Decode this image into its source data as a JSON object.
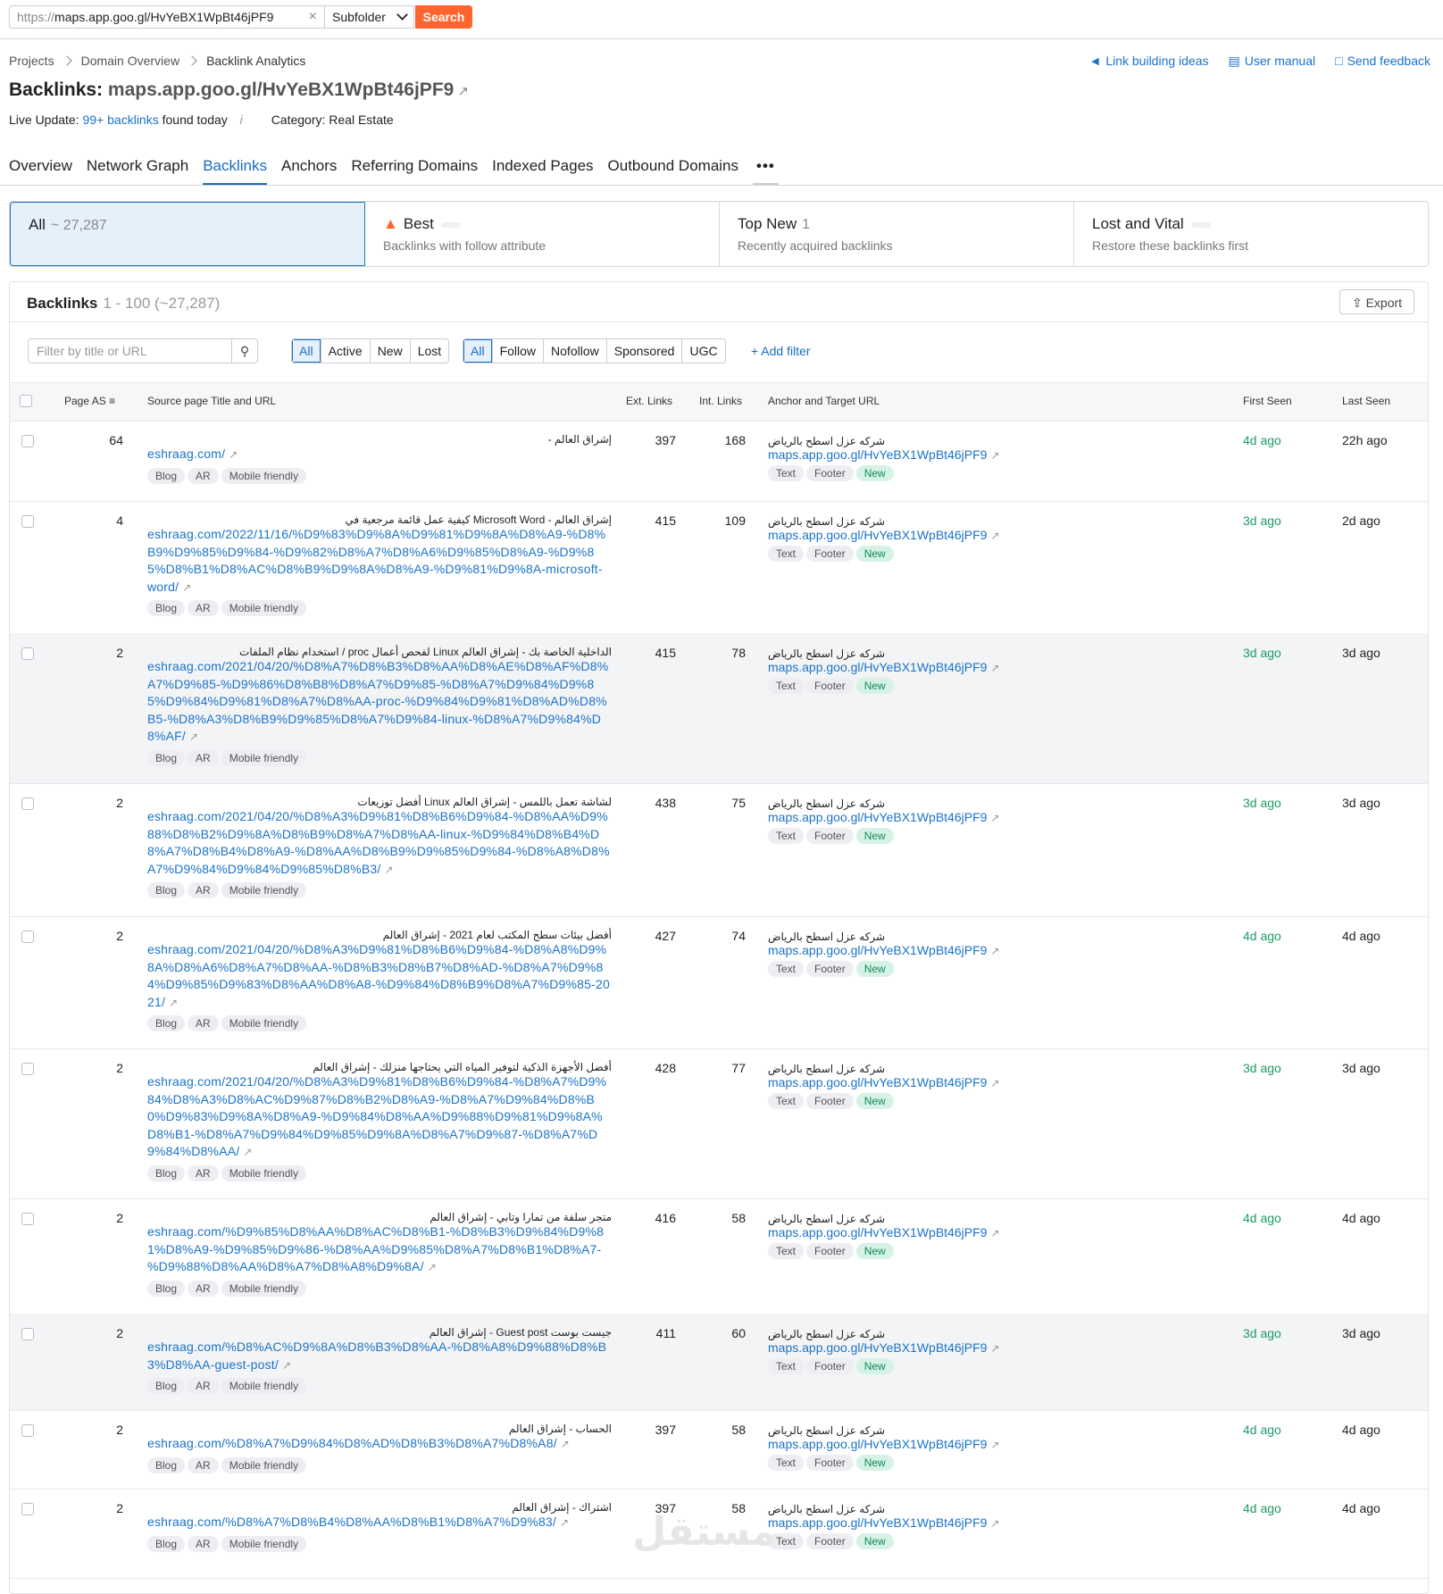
{
  "search": {
    "proto": "https://",
    "value": "maps.app.goo.gl/HvYeBX1WpBt46jPF9",
    "clear": "×",
    "scope": "Subfolder",
    "button": "Search"
  },
  "breadcrumb": [
    "Projects",
    "Domain Overview",
    "Backlink Analytics"
  ],
  "top_links": [
    "Link building ideas",
    "User manual",
    "Send feedback"
  ],
  "title": {
    "prefix": "Backlinks:",
    "domain": "maps.app.goo.gl/HvYeBX1WpBt46jPF9"
  },
  "live": {
    "label": "Live Update:",
    "count": "99+ backlinks",
    "suffix": "found today",
    "info": "i",
    "category_label": "Category:",
    "category": "Real Estate"
  },
  "tabs": [
    "Overview",
    "Network Graph",
    "Backlinks",
    "Anchors",
    "Referring Domains",
    "Indexed Pages",
    "Outbound Domains",
    "•••"
  ],
  "cards": [
    {
      "title": "All",
      "count": "~ 27,287",
      "sub": ""
    },
    {
      "title": "Best",
      "count": "",
      "sub": "Backlinks with follow attribute"
    },
    {
      "title": "Top New",
      "count": "1",
      "sub": "Recently acquired backlinks"
    },
    {
      "title": "Lost and Vital",
      "count": "",
      "sub": "Restore these backlinks first"
    }
  ],
  "panel": {
    "title": "Backlinks",
    "range": "1 - 100 (~27,287)",
    "export": "Export"
  },
  "filter": {
    "placeholder": "Filter by title or URL"
  },
  "seg1": [
    "All",
    "Active",
    "New",
    "Lost"
  ],
  "seg2": [
    "All",
    "Follow",
    "Nofollow",
    "Sponsored",
    "UGC"
  ],
  "add_filter": "Add filter",
  "columns": [
    "Page AS",
    "Source page Title and URL",
    "Ext. Links",
    "Int. Links",
    "Anchor and Target URL",
    "First Seen",
    "Last Seen"
  ],
  "source_tags": [
    "Blog",
    "AR",
    "Mobile friendly"
  ],
  "target_tags": [
    "Text",
    "Footer",
    "New"
  ],
  "anchor": "شركه عزل اسطح بالرياض",
  "target_url": "maps.app.goo.gl/HvYeBX1WpBt46jPF9",
  "rows": [
    {
      "as": "64",
      "title": "إشراق العالم -",
      "url": "eshraag.com/",
      "ext": "397",
      "int": "168",
      "first": "4d ago",
      "last": "22h ago"
    },
    {
      "as": "4",
      "title": "إشراق العالم - Microsoft Word كيفية عمل قائمة مرجعية في",
      "url": "eshraag.com/2022/11/16/%D9%83%D9%8A%D9%81%D9%8A%D8%A9-%D8%B9%D9%85%D9%84-%D9%82%D8%A7%D8%A6%D9%85%D8%A9-%D9%85%D8%B1%D8%AC%D8%B9%D9%8A%D8%A9-%D9%81%D9%8A-microsoft-word/",
      "ext": "415",
      "int": "109",
      "first": "3d ago",
      "last": "2d ago"
    },
    {
      "as": "2",
      "title": "الداخلية الخاصة بك - إشراق العالم Linux لفحص أعمال proc / استخدام نظام الملفات",
      "url": "eshraag.com/2021/04/20/%D8%A7%D8%B3%D8%AA%D8%AE%D8%AF%D8%A7%D9%85-%D9%86%D8%B8%D8%A7%D9%85-%D8%A7%D9%84%D9%85%D9%84%D9%81%D8%A7%D8%AA-proc-%D9%84%D9%81%D8%AD%D8%B5-%D8%A3%D8%B9%D9%85%D8%A7%D9%84-linux-%D8%A7%D9%84%D8%AF/",
      "ext": "415",
      "int": "78",
      "first": "3d ago",
      "last": "3d ago"
    },
    {
      "as": "2",
      "title": "لشاشة تعمل باللمس - إشراق العالم Linux أفضل توزيعات",
      "url": "eshraag.com/2021/04/20/%D8%A3%D9%81%D8%B6%D9%84-%D8%AA%D9%88%D8%B2%D9%8A%D8%B9%D8%A7%D8%AA-linux-%D9%84%D8%B4%D8%A7%D8%B4%D8%A9-%D8%AA%D8%B9%D9%85%D9%84-%D8%A8%D8%A7%D9%84%D9%84%D9%85%D8%B3/",
      "ext": "438",
      "int": "75",
      "first": "3d ago",
      "last": "3d ago"
    },
    {
      "as": "2",
      "title": "أفضل بيئات سطح المكتب لعام 2021 - إشراق العالم",
      "url": "eshraag.com/2021/04/20/%D8%A3%D9%81%D8%B6%D9%84-%D8%A8%D9%8A%D8%A6%D8%A7%D8%AA-%D8%B3%D8%B7%D8%AD-%D8%A7%D9%84%D9%85%D9%83%D8%AA%D8%A8-%D9%84%D8%B9%D8%A7%D9%85-2021/",
      "ext": "427",
      "int": "74",
      "first": "4d ago",
      "last": "4d ago"
    },
    {
      "as": "2",
      "title": "أفضل الأجهزة الذكية لتوفير المياه التي يحتاجها منزلك - إشراق العالم",
      "url": "eshraag.com/2021/04/20/%D8%A3%D9%81%D8%B6%D9%84-%D8%A7%D9%84%D8%A3%D8%AC%D9%87%D8%B2%D8%A9-%D8%A7%D9%84%D8%B0%D9%83%D9%8A%D8%A9-%D9%84%D8%AA%D9%88%D9%81%D9%8A%D8%B1-%D8%A7%D9%84%D9%85%D9%8A%D8%A7%D9%87-%D8%A7%D9%84%D8%AA/",
      "ext": "428",
      "int": "77",
      "first": "3d ago",
      "last": "3d ago"
    },
    {
      "as": "2",
      "title": "متجر سلفة من تمارا وتابي - إشراق العالم",
      "url": "eshraag.com/%D9%85%D8%AA%D8%AC%D8%B1-%D8%B3%D9%84%D9%81%D8%A9-%D9%85%D9%86-%D8%AA%D9%85%D8%A7%D8%B1%D8%A7-%D9%88%D8%AA%D8%A7%D8%A8%D9%8A/",
      "ext": "416",
      "int": "58",
      "first": "4d ago",
      "last": "4d ago"
    },
    {
      "as": "2",
      "title": "جيست بوست Guest post - إشراق العالم",
      "url": "eshraag.com/%D8%AC%D9%8A%D8%B3%D8%AA-%D8%A8%D9%88%D8%B3%D8%AA-guest-post/",
      "ext": "411",
      "int": "60",
      "first": "3d ago",
      "last": "3d ago"
    },
    {
      "as": "2",
      "title": "الحساب - إشراق العالم",
      "url": "eshraag.com/%D8%A7%D9%84%D8%AD%D8%B3%D8%A7%D8%A8/",
      "ext": "397",
      "int": "58",
      "first": "4d ago",
      "last": "4d ago"
    },
    {
      "as": "2",
      "title": "اشتراك - إشراق العالم",
      "url": "eshraag.com/%D8%A7%D8%B4%D8%AA%D8%B1%D8%A7%D9%83/",
      "ext": "397",
      "int": "58",
      "first": "4d ago",
      "last": "4d ago"
    }
  ],
  "watermark": "مستقل"
}
